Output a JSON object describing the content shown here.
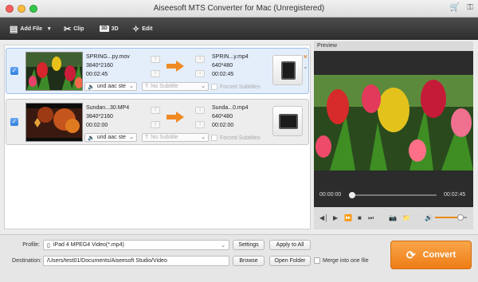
{
  "window": {
    "title": "Aiseesoft MTS Converter for Mac (Unregistered)"
  },
  "toolbar": {
    "add_file": "Add File",
    "clip": "Clip",
    "three_d": "3D",
    "three_d_box": "3D",
    "edit": "Edit"
  },
  "files": [
    {
      "source_name": "SPRING...py.mov",
      "source_res": "3840*2160",
      "source_dur": "00:02:45",
      "target_name": "SPRIN...y.mp4",
      "target_res": "640*480",
      "target_dur": "00:02:45",
      "audio": "und aac ste",
      "subtitle": "No Subtitle",
      "forced_subtitles": "Forced Subtitles"
    },
    {
      "source_name": "Sundan...30.MP4",
      "source_res": "3840*2160",
      "source_dur": "00:02:00",
      "target_name": "Sunda...0.mp4",
      "target_res": "640*480",
      "target_dur": "00:02:00",
      "audio": "und aac ste",
      "subtitle": "No Subtitle",
      "forced_subtitles": "Forced Subtitles"
    }
  ],
  "preview": {
    "label": "Preview",
    "time_current": "00:00:00",
    "time_total": "00:02:45",
    "playback_progress": 0.02,
    "volume": 0.8
  },
  "bottom": {
    "profile_label": "Profile:",
    "profile_value": "iPad 4 MPEG4 Video(*.mp4)",
    "settings": "Settings",
    "apply_to_all": "Apply to All",
    "destination_label": "Destination:",
    "destination_value": "/Users/test01/Documents/Aiseesoft Studio/Video",
    "browse": "Browse",
    "open_folder": "Open Folder",
    "merge": "Merge into one file"
  },
  "convert": {
    "label": "Convert"
  },
  "colors": {
    "accent": "#ee7d16",
    "selection": "#e4eefb",
    "toolbar": "#3a3a3a"
  }
}
